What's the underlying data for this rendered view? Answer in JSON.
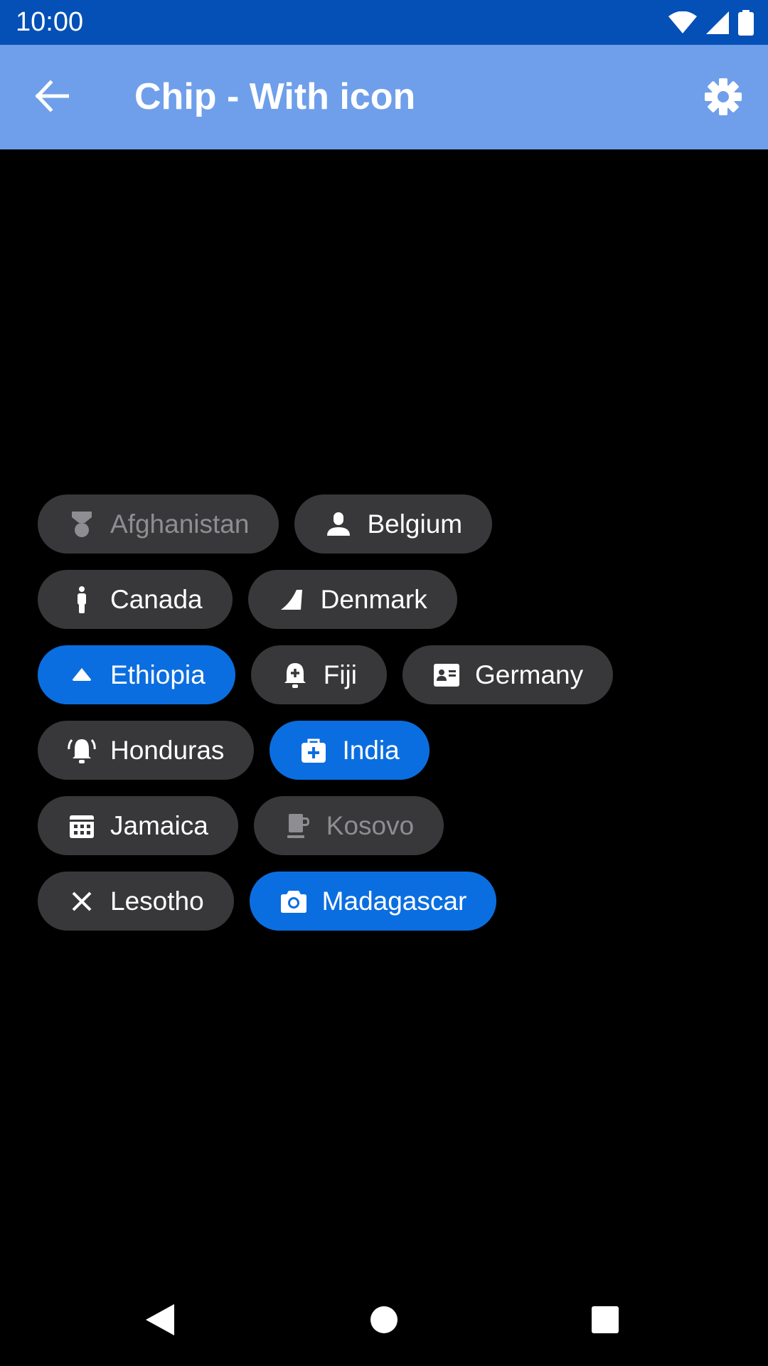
{
  "status_bar": {
    "time": "10:00",
    "icons": [
      "wifi-icon",
      "signal-icon",
      "battery-icon"
    ]
  },
  "app_bar": {
    "title": "Chip - With icon",
    "back_icon": "arrow-back-icon",
    "settings_icon": "gear-icon"
  },
  "colors": {
    "status_bar": "#0450B6",
    "app_bar": "#6F9FEA",
    "chip_default": "#38383A",
    "chip_selected": "#0B6EE0",
    "disabled_text": "#8E8E92"
  },
  "chips": [
    {
      "label": "Afghanistan",
      "icon": "medal-icon",
      "state": "disabled"
    },
    {
      "label": "Belgium",
      "icon": "person-icon",
      "state": "default"
    },
    {
      "label": "Canada",
      "icon": "standing-person-icon",
      "state": "default"
    },
    {
      "label": "Denmark",
      "icon": "parallelogram-icon",
      "state": "default"
    },
    {
      "label": "Ethiopia",
      "icon": "triangle-up-icon",
      "state": "selected"
    },
    {
      "label": "Fiji",
      "icon": "bell-add-icon",
      "state": "default"
    },
    {
      "label": "Germany",
      "icon": "contact-card-icon",
      "state": "default"
    },
    {
      "label": "Honduras",
      "icon": "bell-ringing-icon",
      "state": "default"
    },
    {
      "label": "India",
      "icon": "medical-bag-icon",
      "state": "selected"
    },
    {
      "label": "Jamaica",
      "icon": "calendar-icon",
      "state": "default"
    },
    {
      "label": "Kosovo",
      "icon": "mug-icon",
      "state": "disabled"
    },
    {
      "label": "Lesotho",
      "icon": "close-icon",
      "state": "default"
    },
    {
      "label": "Madagascar",
      "icon": "camera-icon",
      "state": "selected"
    }
  ],
  "nav_bar": {
    "icons": [
      "nav-back-icon",
      "nav-home-icon",
      "nav-recents-icon"
    ]
  }
}
